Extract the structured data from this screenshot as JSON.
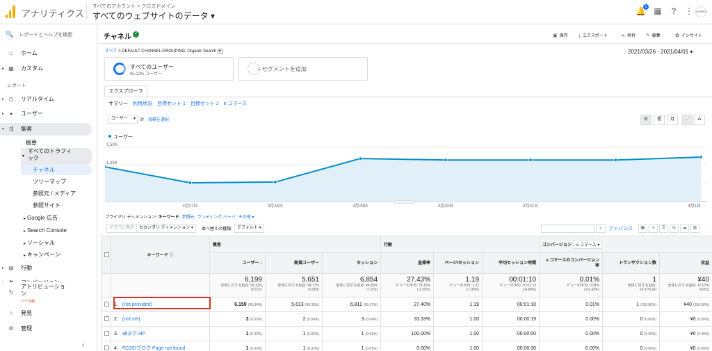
{
  "header": {
    "app_name": "アナリティクス",
    "account_path": "すべてのアカウント > クロスドメイン",
    "view_name": "すべてのウェブサイトのデータ ▾",
    "notification_count": "1",
    "avatar_text": "AURINO"
  },
  "sidebar": {
    "search_placeholder": "レポートとヘルプを検索",
    "home": "ホーム",
    "custom": "カスタム",
    "reports_label": "レポート",
    "realtime": "リアルタイム",
    "audience": "ユーザー",
    "acquisition": "集客",
    "overview": "概要",
    "all_traffic": "すべてのトラフィ\nック",
    "channels": "チャネル",
    "treemap": "ツリーマップ",
    "source_medium": "参照元 / メディア",
    "referrals": "参照サイト",
    "google_ads": "Google 広告",
    "search_console": "Search Console",
    "social": "ソーシャル",
    "campaigns": "キャンペーン",
    "behavior": "行動",
    "conversions": "コンバージョン",
    "attribution": "アトリビューショ\nン",
    "beta": "ベータ版",
    "discover": "発見",
    "admin": "管理"
  },
  "page": {
    "title": "チャネル",
    "actions": {
      "save": "保存",
      "export": "エクスポート",
      "share": "共有",
      "edit": "編集",
      "insights": "インサイト"
    },
    "breadcrumb_all": "すべて",
    "breadcrumb_rest": "> DEFAULT CHANNEL GROUPING: Organic Search",
    "date_range": "2021/03/26 - 2021/04/01",
    "segment_title": "すべてのユーザー",
    "segment_sub": "95.12% ユーザー",
    "segment_add": "+ セグメントを追加",
    "explorer_tab": "エクスプローラ",
    "subtabs": [
      "サマリー",
      "利用状況",
      "目標セット 1",
      "目標セット 2",
      "e コマース"
    ],
    "metric_select": "ユーザー",
    "vs": "対",
    "select_metric": "指標を選択",
    "period": {
      "day": "日",
      "week": "週",
      "month": "月"
    },
    "primary_dimension_label": "プライマリ ディメンション:",
    "primary_dimension_keyword": "キーワード",
    "primary_dimension_source": "参照元",
    "primary_dimension_landing": "ランディング ページ",
    "primary_dimension_other": "その他 ▾",
    "plot_rows": "グラフに表示",
    "secondary_dimension": "セカンダリ ディメンション ▾",
    "sort_type": "並べ替えの種類:",
    "default": "デフォルト ▾",
    "advanced": "アドバンス"
  },
  "chart_data": {
    "type": "line",
    "series": [
      {
        "name": "ユーザー",
        "values": [
          960,
          520,
          540,
          1190,
          1150,
          1150,
          1150,
          1230
        ]
      }
    ],
    "x": [
      "",
      "3月27日",
      "3月28日",
      "3月29日",
      "3月30日",
      "3月31日",
      "",
      "4月1日"
    ],
    "ylim": [
      0,
      1500
    ],
    "yticks": [
      "500",
      "1,000",
      "1,500"
    ],
    "color": "#058dc7"
  },
  "table": {
    "group_headers": {
      "acquisition": "集客",
      "behavior": "行動",
      "conversions": "コンバージョン",
      "ecommerce": "e コマース ▾"
    },
    "columns": [
      "キーワード",
      "ユーザー",
      "新規ユーザー",
      "セッション",
      "直帰率",
      "ページ/セッション",
      "平均セッション時間",
      "e コマースのコンバージョン率",
      "トランザクション数",
      "収益"
    ],
    "totals": [
      {
        "value": "6,199",
        "sub": "全体に対する割合: 95.12%\n(6,517)"
      },
      {
        "value": "5,651",
        "sub": "全体に対する割合: 94.77%\n(5,963)"
      },
      {
        "value": "6,854",
        "sub": "全体に対する割合: 94.85%\n(7,226)"
      },
      {
        "value": "27.43%",
        "sub": "ビューの平均: 28.15%\n(-2.55%)"
      },
      {
        "value": "1.19",
        "sub": "ビューの平均: 1.22\n(-1.93%)"
      },
      {
        "value": "00:01:10",
        "sub": "ビューの平均: 00:01:13\n(-4.49%)"
      },
      {
        "value": "0.01%",
        "sub": "ビューの平均: 0.08%\n(-82.43%)"
      },
      {
        "value": "1",
        "sub": "全体に対する割合:\n16.67% (6)"
      },
      {
        "value": "¥40",
        "sub": "全体に対する割合: 16.07%\n(¥251)"
      }
    ],
    "rows": [
      {
        "idx": "1.",
        "keyword": "(not provided)",
        "users": "6,159",
        "users_pct": "(99.34%)",
        "new": "5,613",
        "new_pct": "(99.33%)",
        "sessions": "6,811",
        "sessions_pct": "(99.37%)",
        "bounce": "27.40%",
        "pps": "1.19",
        "dur": "00:01:10",
        "cr": "0.01%",
        "tx": "1",
        "tx_pct": "(100.00%)",
        "rev": "¥40",
        "rev_pct": "(100.00%)"
      },
      {
        "idx": "2.",
        "keyword": "(not set)",
        "users": "3",
        "users_pct": "(0.05%)",
        "new": "2",
        "new_pct": "(0.04%)",
        "sessions": "3",
        "sessions_pct": "(0.04%)",
        "bounce": "33.33%",
        "pps": "1.00",
        "dur": "00:00:19",
        "cr": "0.00%",
        "tx": "0",
        "tx_pct": "(0.00%)",
        "rev": "¥0",
        "rev_pct": "(0.00%)"
      },
      {
        "idx": "3.",
        "keyword": "altタグ HP",
        "users": "1",
        "users_pct": "(0.02%)",
        "new": "1",
        "new_pct": "(0.02%)",
        "sessions": "1",
        "sessions_pct": "(0.01%)",
        "bounce": "100.00%",
        "pps": "1.00",
        "dur": "00:00:00",
        "cr": "0.00%",
        "tx": "0",
        "tx_pct": "(0.00%)",
        "rev": "¥0",
        "rev_pct": "(0.00%)"
      },
      {
        "idx": "4.",
        "keyword": "FC2IDブログ Page not found",
        "users": "1",
        "users_pct": "(0.02%)",
        "new": "1",
        "new_pct": "(0.02%)",
        "sessions": "1",
        "sessions_pct": "(0.01%)",
        "bounce": "0.00%",
        "pps": "1.00",
        "dur": "00:00:30",
        "cr": "0.00%",
        "tx": "0",
        "tx_pct": "(0.00%)",
        "rev": "¥0",
        "rev_pct": "(0.00%)"
      }
    ]
  }
}
